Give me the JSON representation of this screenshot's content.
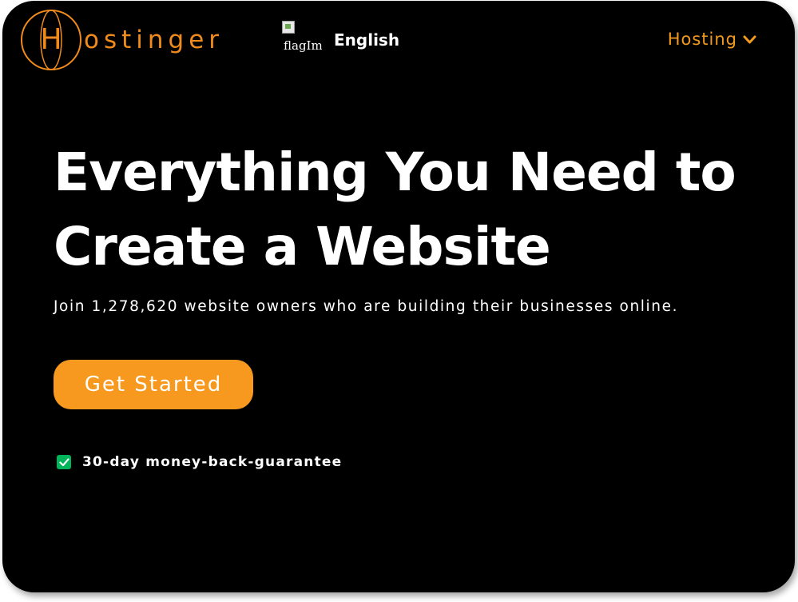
{
  "brand": {
    "logo_letter": "H",
    "logo_rest": "ostinger",
    "color": "#f08a1c"
  },
  "header": {
    "flag_alt": "flagImg",
    "language": "English",
    "nav_hosting": "Hosting"
  },
  "hero": {
    "headline_line1": "Everything You Need to",
    "headline_line2": "Create a Website",
    "subtitle": "Join 1,278,620 website owners who are building their businesses online.",
    "cta_label": "Get Started",
    "guarantee": "30-day money-back-guarantee"
  },
  "colors": {
    "background": "#000000",
    "accent": "#f7991f",
    "check": "#00b45a",
    "text": "#ffffff"
  }
}
